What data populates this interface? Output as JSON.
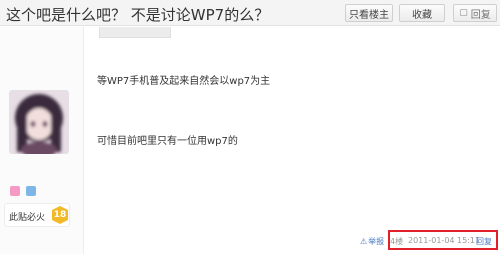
{
  "header": {
    "title": "这个吧是什么吧？ 不是讨论WP7的么？",
    "only_louzhu": "只看楼主",
    "favorite": "收藏",
    "reply": "回复"
  },
  "post": {
    "gray_button": "",
    "line1": "等WP7手机普及起来自然会以wp7为主",
    "line2": "可惜目前吧里只有一位用wp7的"
  },
  "user": {
    "username": "",
    "level_title": "此贴必火",
    "level": "18"
  },
  "footer": {
    "report": "举报",
    "floor": "4楼",
    "time": "2011-01-04 15:11",
    "reply": "回复"
  },
  "colors": {
    "link": "#4a7bc4",
    "highlight": "#e0202a",
    "level_badge": "#f2b928"
  }
}
